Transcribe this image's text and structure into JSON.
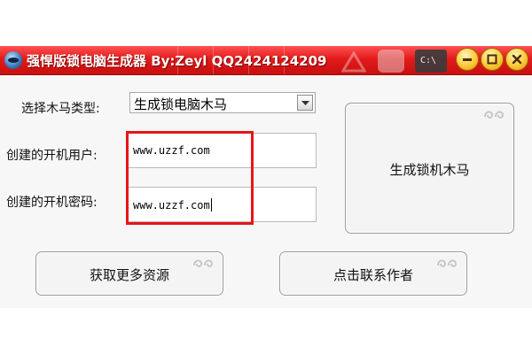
{
  "window": {
    "title": "强悍版锁电脑生成器 By:Zeyl QQ2424124209",
    "taskbar_label": "C:\\"
  },
  "form": {
    "type_label": "选择木马类型:",
    "type_value": "生成锁电脑木马",
    "user_label": "创建的开机用户:",
    "user_value": "www.uzzf.com",
    "password_label": "创建的开机密码:",
    "password_value": "www.uzzf.com"
  },
  "buttons": {
    "generate": "生成锁机木马",
    "resources": "获取更多资源",
    "contact": "点击联系作者"
  },
  "colors": {
    "titlebar": "#e21b1b",
    "highlight_border": "#e5161a",
    "window_controls": "#ffd24a"
  }
}
